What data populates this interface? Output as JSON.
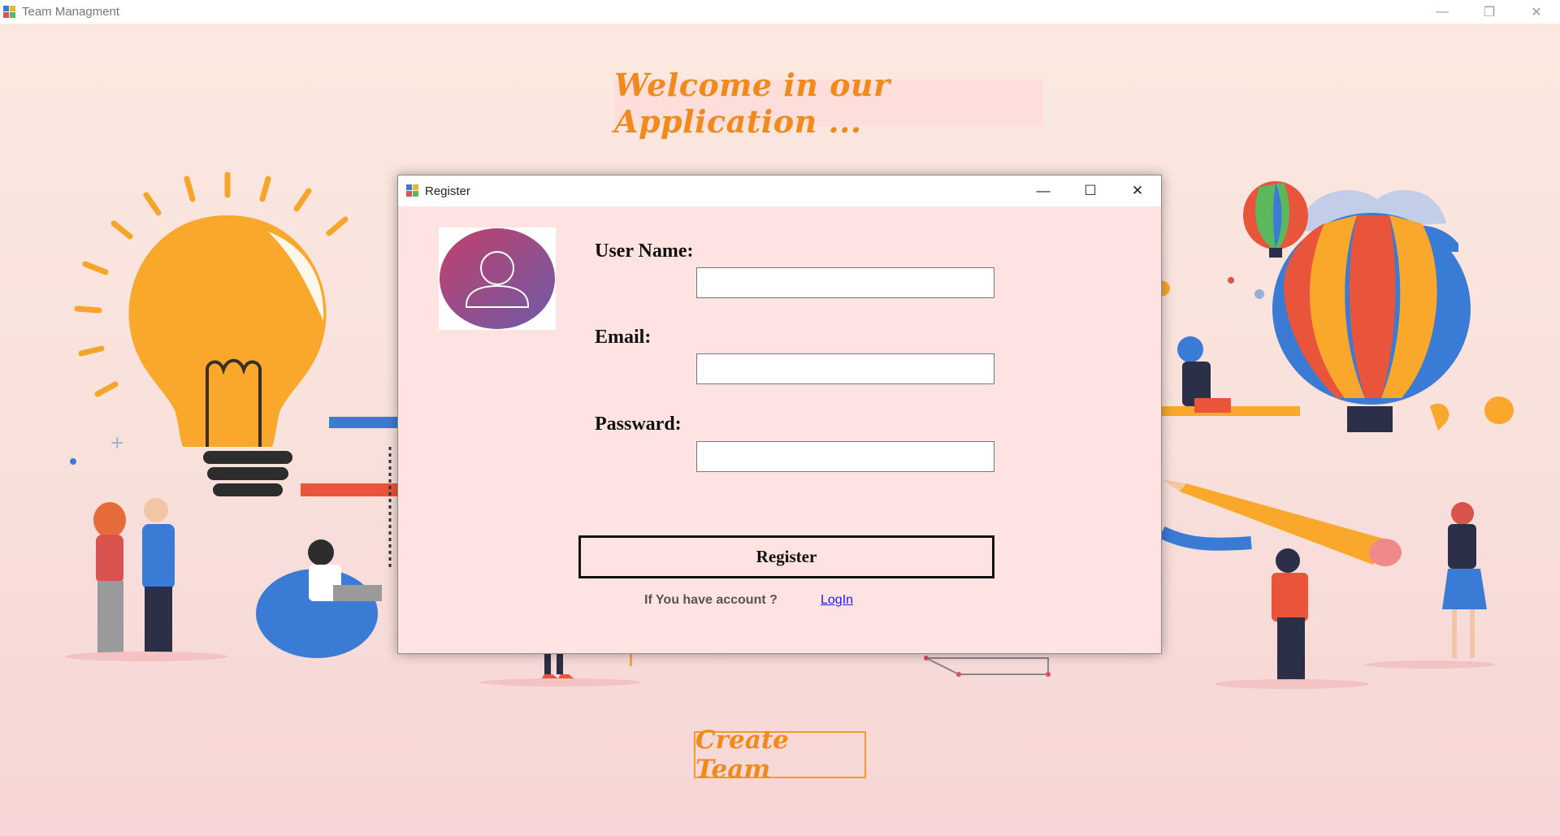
{
  "window": {
    "title": "Team Managment",
    "controls": {
      "minimize": "—",
      "restore": "❐",
      "close": "✕"
    }
  },
  "main": {
    "welcome_text": "Welcome in our Application ...",
    "create_team_label": "Create Team"
  },
  "dialog": {
    "title": "Register",
    "controls": {
      "minimize": "—",
      "maximize": "☐",
      "close": "✕"
    },
    "username_label": "User Name:",
    "email_label": "Email:",
    "password_label": "Passward:",
    "username_value": "",
    "email_value": "",
    "password_value": "",
    "register_label": "Register",
    "account_prompt": "If You have account ?",
    "login_label": "LogIn"
  },
  "icons": {
    "app": "windows-forms-app-icon",
    "avatar": "user-avatar-icon"
  },
  "colors": {
    "accent_orange": "#f08a1c",
    "dialog_bg": "#ffe3e2",
    "link_blue": "#1a1aff"
  }
}
